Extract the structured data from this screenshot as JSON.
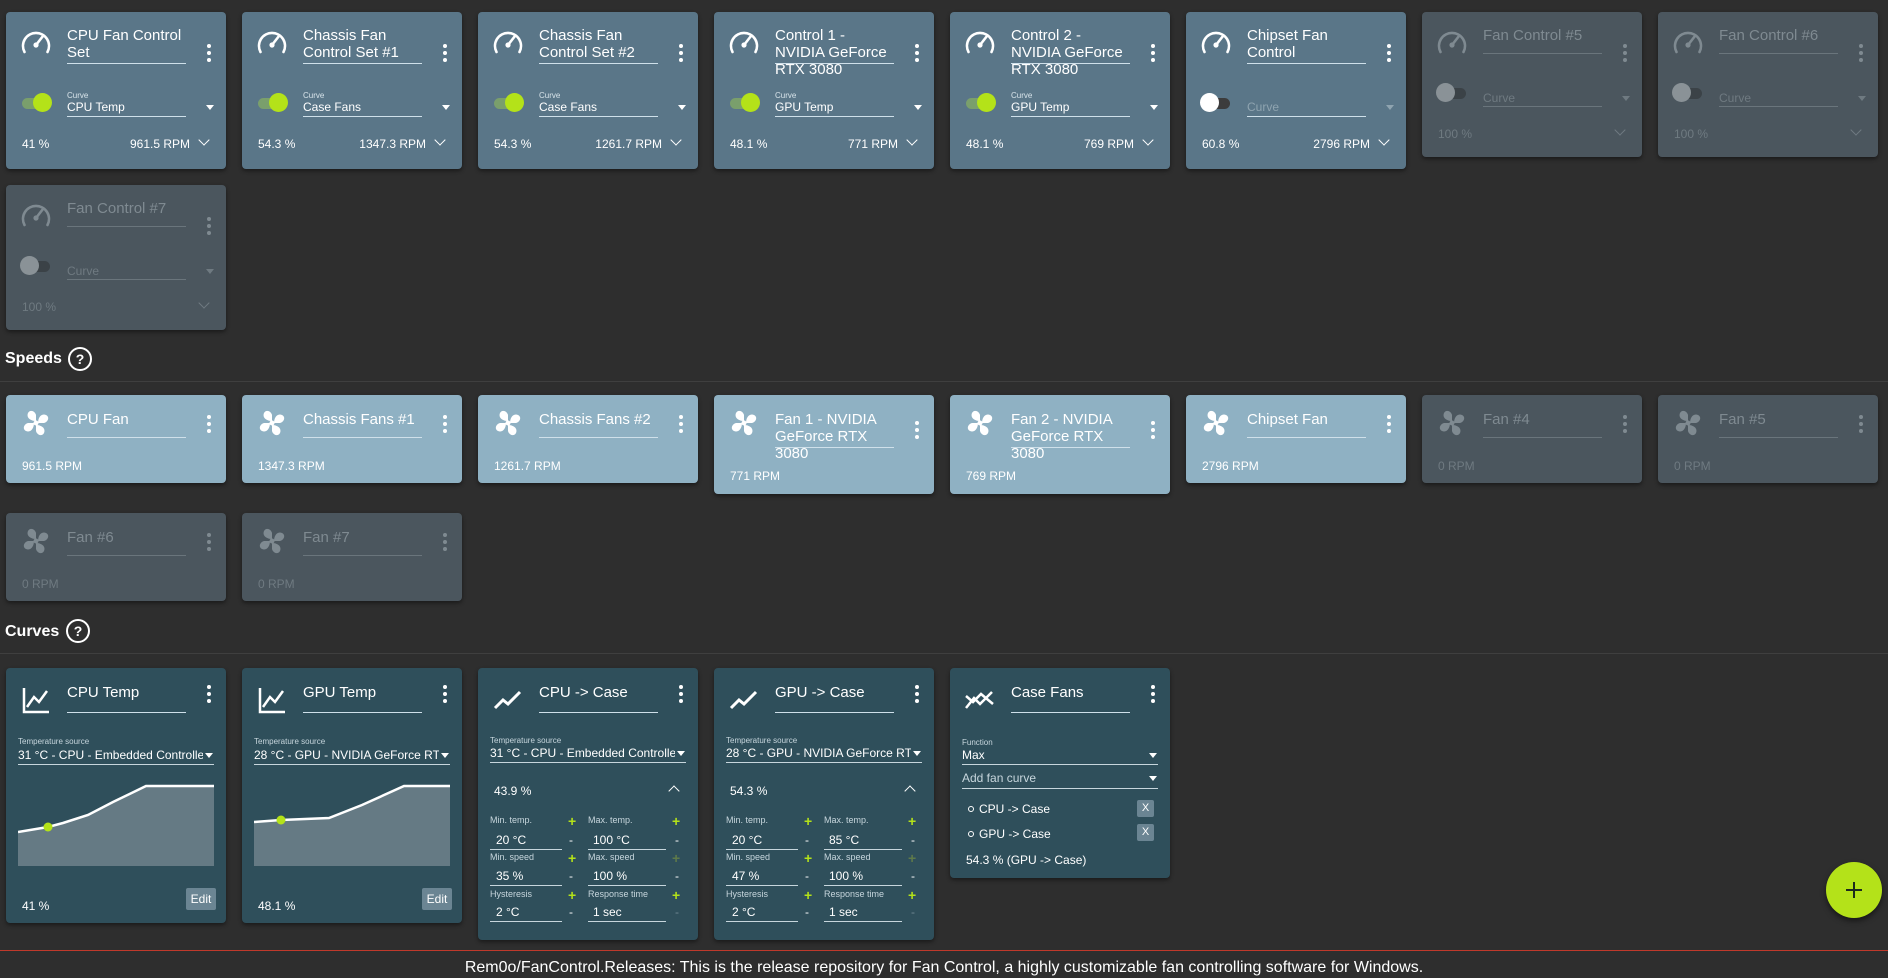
{
  "controls": [
    {
      "name": "CPU Fan Control Set",
      "curve_label": "Curve",
      "curve": "CPU Temp",
      "enabled": true,
      "percent": "41 %",
      "rpm": "961.5 RPM"
    },
    {
      "name": "Chassis Fan Control Set #1",
      "curve_label": "Curve",
      "curve": "Case Fans",
      "enabled": true,
      "percent": "54.3 %",
      "rpm": "1347.3 RPM"
    },
    {
      "name": "Chassis Fan Control Set #2",
      "curve_label": "Curve",
      "curve": "Case Fans",
      "enabled": true,
      "percent": "54.3 %",
      "rpm": "1261.7 RPM"
    },
    {
      "name": "Control 1 - NVIDIA GeForce RTX 3080",
      "curve_label": "Curve",
      "curve": "GPU Temp",
      "enabled": true,
      "percent": "48.1 %",
      "rpm": "771 RPM"
    },
    {
      "name": "Control 2 - NVIDIA GeForce RTX 3080",
      "curve_label": "Curve",
      "curve": "GPU Temp",
      "enabled": true,
      "percent": "48.1 %",
      "rpm": "769 RPM"
    },
    {
      "name": "Chipset Fan Control",
      "curve_placeholder": "Curve",
      "enabled": false,
      "percent": "60.8 %",
      "rpm": "2796 RPM"
    },
    {
      "name": "Fan Control #5",
      "curve_placeholder": "Curve",
      "enabled": false,
      "percent": "100 %",
      "rpm": ""
    },
    {
      "name": "Fan Control #6",
      "curve_placeholder": "Curve",
      "enabled": false,
      "percent": "100 %",
      "rpm": ""
    },
    {
      "name": "Fan Control #7",
      "curve_placeholder": "Curve",
      "enabled": false,
      "percent": "100 %",
      "rpm": ""
    }
  ],
  "speeds_header": "Speeds",
  "speeds": [
    {
      "name": "CPU Fan",
      "rpm": "961.5 RPM"
    },
    {
      "name": "Chassis Fans #1",
      "rpm": "1347.3 RPM"
    },
    {
      "name": "Chassis Fans #2",
      "rpm": "1261.7 RPM"
    },
    {
      "name": "Fan 1 - NVIDIA GeForce RTX 3080",
      "rpm": "771 RPM"
    },
    {
      "name": "Fan 2 - NVIDIA GeForce RTX 3080",
      "rpm": "769 RPM"
    },
    {
      "name": "Chipset Fan",
      "rpm": "2796 RPM"
    },
    {
      "name": "Fan #4",
      "rpm": "0 RPM"
    },
    {
      "name": "Fan #5",
      "rpm": "0 RPM"
    },
    {
      "name": "Fan #6",
      "rpm": "0 RPM"
    },
    {
      "name": "Fan #7",
      "rpm": "0 RPM"
    }
  ],
  "curves_header": "Curves",
  "help_glyph": "?",
  "curves": [
    {
      "name": "CPU Temp",
      "source_label": "Temperature source",
      "source": "31 °C - CPU - Embedded Controller",
      "percent": "41 %",
      "edit": "Edit"
    },
    {
      "name": "GPU Temp",
      "source_label": "Temperature source",
      "source": "28 °C - GPU - NVIDIA GeForce RTX 3080",
      "percent": "48.1 %",
      "edit": "Edit"
    },
    {
      "name": "CPU -> Case",
      "source_label": "Temperature source",
      "source": "31 °C - CPU - Embedded Controller",
      "percent": "43.9 %",
      "min_temp_label": "Min. temp.",
      "min_temp": "20 °C",
      "max_temp_label": "Max. temp.",
      "max_temp": "100 °C",
      "min_speed_label": "Min. speed",
      "min_speed": "35 %",
      "max_speed_label": "Max. speed",
      "max_speed": "100 %",
      "hyst_label": "Hysteresis",
      "hyst": "2 °C",
      "resp_label": "Response time",
      "resp": "1 sec"
    },
    {
      "name": "GPU -> Case",
      "source_label": "Temperature source",
      "source": "28 °C - GPU - NVIDIA GeForce RTX 3080",
      "percent": "54.3 %",
      "min_temp_label": "Min. temp.",
      "min_temp": "20 °C",
      "max_temp_label": "Max. temp.",
      "max_temp": "85 °C",
      "min_speed_label": "Min. speed",
      "min_speed": "47 %",
      "max_speed_label": "Max. speed",
      "max_speed": "100 %",
      "hyst_label": "Hysteresis",
      "hyst": "2 °C",
      "resp_label": "Response time",
      "resp": "1 sec"
    },
    {
      "name": "Case Fans",
      "function_label": "Function",
      "function": "Max",
      "add_placeholder": "Add fan curve",
      "items": [
        "CPU -> Case",
        "GPU -> Case"
      ],
      "remove": "X",
      "result": "54.3 % (GPU -> Case)"
    }
  ],
  "fab_label": "+",
  "footer": "Rem0o/FanControl.Releases: This is the release repository for Fan Control, a highly customizable fan controlling software for Windows.",
  "colors": {
    "accent": "#b4e219",
    "control_card": "#5a7688",
    "speed_card": "#8fb1c3",
    "curve_card": "#2f4f5b",
    "disabled_card": "#4b565e",
    "background": "#2e2e2e"
  }
}
